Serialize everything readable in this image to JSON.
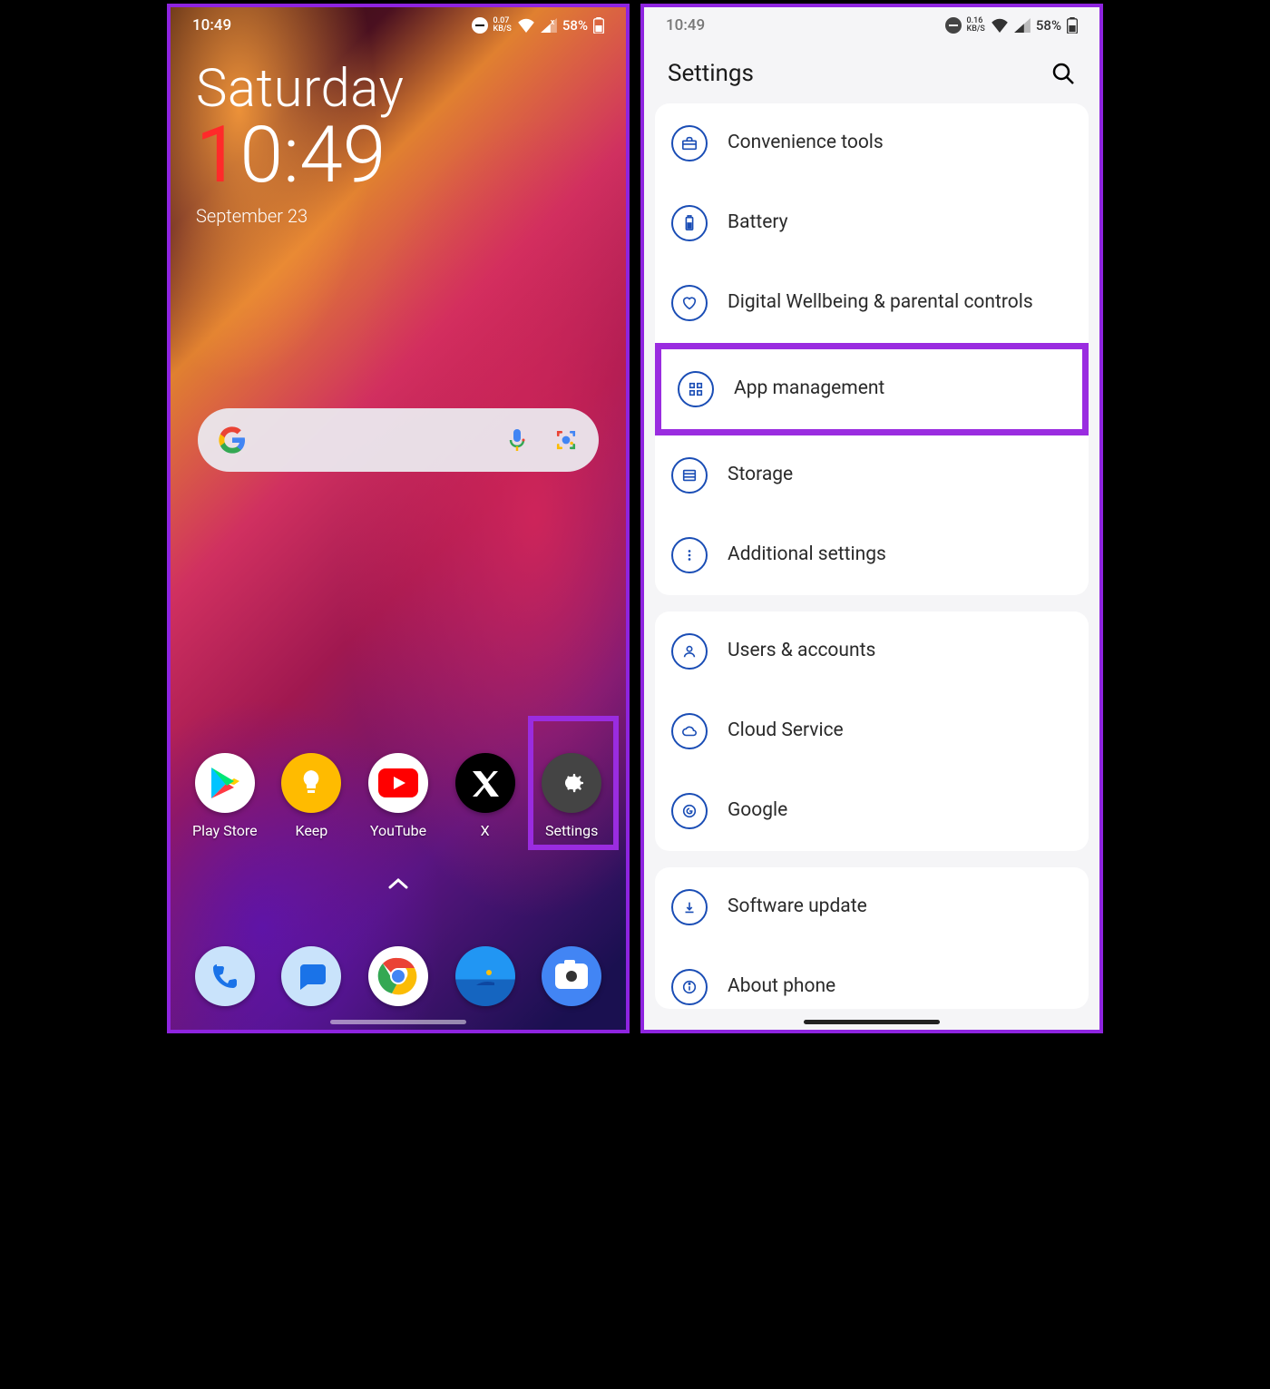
{
  "left": {
    "status": {
      "time": "10:49",
      "kbs": "0.07",
      "kbs_unit": "KB/S",
      "battery": "58%"
    },
    "day": "Saturday",
    "clock_h1": "1",
    "clock_rest": "0:49",
    "date": "September 23",
    "apps_top": [
      {
        "label": "Play Store"
      },
      {
        "label": "Keep"
      },
      {
        "label": "YouTube"
      },
      {
        "label": "X"
      },
      {
        "label": "Settings"
      }
    ]
  },
  "right": {
    "status": {
      "time": "10:49",
      "kbs": "0.16",
      "kbs_unit": "KB/S",
      "battery": "58%"
    },
    "title": "Settings",
    "items": [
      {
        "label": "Convenience tools"
      },
      {
        "label": "Battery"
      },
      {
        "label": "Digital Wellbeing & parental controls"
      },
      {
        "label": "App management"
      },
      {
        "label": "Storage"
      },
      {
        "label": "Additional settings"
      },
      {
        "label": "Users & accounts"
      },
      {
        "label": "Cloud Service"
      },
      {
        "label": "Google"
      },
      {
        "label": "Software update"
      },
      {
        "label": "About phone"
      }
    ]
  }
}
